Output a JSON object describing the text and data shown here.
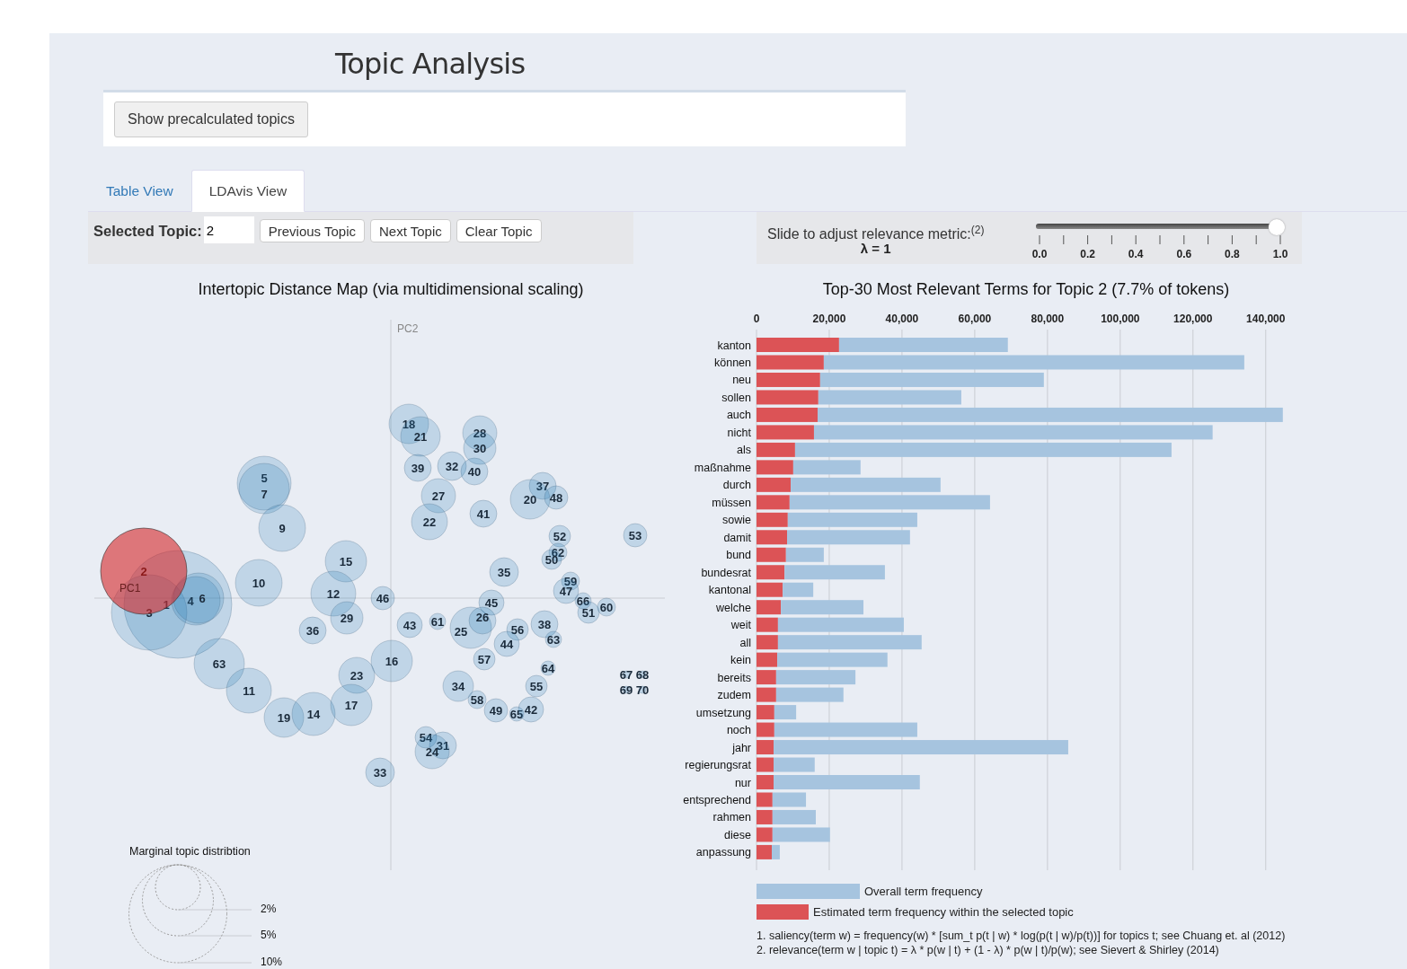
{
  "page_title": "Topic Analysis",
  "precalc_button": "Show precalculated topics",
  "tabs": [
    {
      "label": "Table View",
      "selected": false
    },
    {
      "label": "LDAvis View",
      "selected": true
    }
  ],
  "topic_controls": {
    "label": "Selected Topic:",
    "value": "2",
    "buttons": [
      "Previous Topic",
      "Next Topic",
      "Clear Topic"
    ]
  },
  "relevance_slider": {
    "label": "Slide to adjust relevance metric:$^{(2)}$",
    "lambda_text": "λ = 1",
    "level": 1,
    "tick_labels": [
      "0.0",
      "0.2",
      "0.4",
      "0.6",
      "0.8",
      "1.0"
    ]
  },
  "distance_map": {
    "title": "Intertopic Distance Map (via multidimensional scaling)",
    "axis_x": "PC1",
    "axis_y": "PC2",
    "topics": [
      {
        "label": "1",
        "selected": false
      },
      {
        "label": "3",
        "selected": false
      },
      {
        "label": "4",
        "selected": false
      },
      {
        "label": "6",
        "selected": false
      },
      {
        "label": "5",
        "selected": false
      },
      {
        "label": "7",
        "selected": false
      },
      {
        "label": "9",
        "selected": false
      },
      {
        "label": "10",
        "selected": false
      },
      {
        "label": "15",
        "selected": false
      },
      {
        "label": "12",
        "selected": false
      },
      {
        "label": "29",
        "selected": false
      },
      {
        "label": "46",
        "selected": false
      },
      {
        "label": "36",
        "selected": false
      },
      {
        "label": "63",
        "selected": false
      },
      {
        "label": "11",
        "selected": false
      },
      {
        "label": "19",
        "selected": false
      },
      {
        "label": "14",
        "selected": false
      },
      {
        "label": "23",
        "selected": false
      },
      {
        "label": "17",
        "selected": false
      },
      {
        "label": "16",
        "selected": false
      },
      {
        "label": "33",
        "selected": false
      },
      {
        "label": "18",
        "selected": false
      },
      {
        "label": "21",
        "selected": false
      },
      {
        "label": "28",
        "selected": false
      },
      {
        "label": "30",
        "selected": false
      },
      {
        "label": "39",
        "selected": false
      },
      {
        "label": "32",
        "selected": false
      },
      {
        "label": "40",
        "selected": false
      },
      {
        "label": "27",
        "selected": false
      },
      {
        "label": "22",
        "selected": false
      },
      {
        "label": "41",
        "selected": false
      },
      {
        "label": "37",
        "selected": false
      },
      {
        "label": "20",
        "selected": false
      },
      {
        "label": "48",
        "selected": false
      },
      {
        "label": "52",
        "selected": false
      },
      {
        "label": "62",
        "selected": false
      },
      {
        "label": "50",
        "selected": false
      },
      {
        "label": "53",
        "selected": false
      },
      {
        "label": "35",
        "selected": false
      },
      {
        "label": "59",
        "selected": false
      },
      {
        "label": "47",
        "selected": false
      },
      {
        "label": "45",
        "selected": false
      },
      {
        "label": "66",
        "selected": false
      },
      {
        "label": "51",
        "selected": false
      },
      {
        "label": "60",
        "selected": false
      },
      {
        "label": "43",
        "selected": false
      },
      {
        "label": "61",
        "selected": false
      },
      {
        "label": "25",
        "selected": false
      },
      {
        "label": "26",
        "selected": false
      },
      {
        "label": "56",
        "selected": false
      },
      {
        "label": "38",
        "selected": false
      },
      {
        "label": "63",
        "selected": false
      },
      {
        "label": "44",
        "selected": false
      },
      {
        "label": "57",
        "selected": false
      },
      {
        "label": "64",
        "selected": false
      },
      {
        "label": "34",
        "selected": false
      },
      {
        "label": "55",
        "selected": false
      },
      {
        "label": "58",
        "selected": false
      },
      {
        "label": "49",
        "selected": false
      },
      {
        "label": "65",
        "selected": false
      },
      {
        "label": "42",
        "selected": false
      },
      {
        "label": "54",
        "selected": false
      },
      {
        "label": "31",
        "selected": false
      },
      {
        "label": "24",
        "selected": false
      },
      {
        "label": "67",
        "selected": false
      },
      {
        "label": "69",
        "selected": false
      },
      {
        "label": "70",
        "selected": false
      },
      {
        "label": "68",
        "selected": false
      },
      {
        "label": "2",
        "selected": true
      }
    ],
    "legend": {
      "title": "Marginal topic distribtion",
      "sizes": [
        "2%",
        "5%",
        "10%"
      ]
    }
  },
  "term_chart": {
    "chart_data": {
      "type": "bar",
      "orientation": "horizontal",
      "stacked": true,
      "grid": true,
      "title": "Top-30 Most Relevant Terms for Topic 2 (7.7% of tokens)",
      "categories": [
        "kanton",
        "können",
        "neu",
        "sollen",
        "auch",
        "nicht",
        "als",
        "maßnahme",
        "durch",
        "müssen",
        "sowie",
        "damit",
        "bund",
        "bundesrat",
        "kantonal",
        "welche",
        "weit",
        "all",
        "kein",
        "bereits",
        "zudem",
        "umsetzung",
        "noch",
        "jahr",
        "regierungsrat",
        "nur",
        "entsprechend",
        "rahmen",
        "diese",
        "anpassung"
      ],
      "series": [
        {
          "name": "Estimated term frequency within the selected topic",
          "color": "#dc5356",
          "values": [
            22700,
            18500,
            17500,
            17000,
            16800,
            15800,
            10600,
            10100,
            9400,
            9100,
            8600,
            8400,
            8100,
            7700,
            7200,
            6700,
            5900,
            5900,
            5700,
            5400,
            5400,
            4900,
            4900,
            4700,
            4700,
            4700,
            4400,
            4400,
            4400,
            4200
          ]
        },
        {
          "name": "Overall term frequency",
          "color": "#a6c4df",
          "values": [
            46400,
            115600,
            61500,
            39300,
            127900,
            109600,
            103500,
            18500,
            41200,
            55100,
            35600,
            33800,
            10400,
            27600,
            8400,
            22700,
            34600,
            39500,
            30300,
            21800,
            18500,
            6000,
            39300,
            81000,
            11300,
            40200,
            9200,
            11900,
            15800,
            2200
          ]
        }
      ],
      "xlim": [
        0,
        145000
      ],
      "xticks": [
        0,
        {
          "value": 20000,
          "label": "20,000"
        },
        {
          "value": 40000,
          "label": "40,000"
        },
        {
          "value": 60000,
          "label": "60,000"
        },
        {
          "value": 80000,
          "label": "80,000"
        },
        {
          "value": 100000,
          "label": "100,000"
        },
        {
          "value": 120000,
          "label": "120,000"
        },
        {
          "value": 140000,
          "label": "140,000"
        }
      ]
    },
    "footnotes": [
      "1. saliency(term w) = frequency(w) * [sum_t p(t | w) * log(p(t | w)/p(t))] for topics t; see Chuang et. al (2012)",
      "2. relevance(term w | topic t) = λ * p(w | t) + (1 - λ) * p(w | t)/p(w); see Sievert & Shirley (2014)"
    ]
  }
}
